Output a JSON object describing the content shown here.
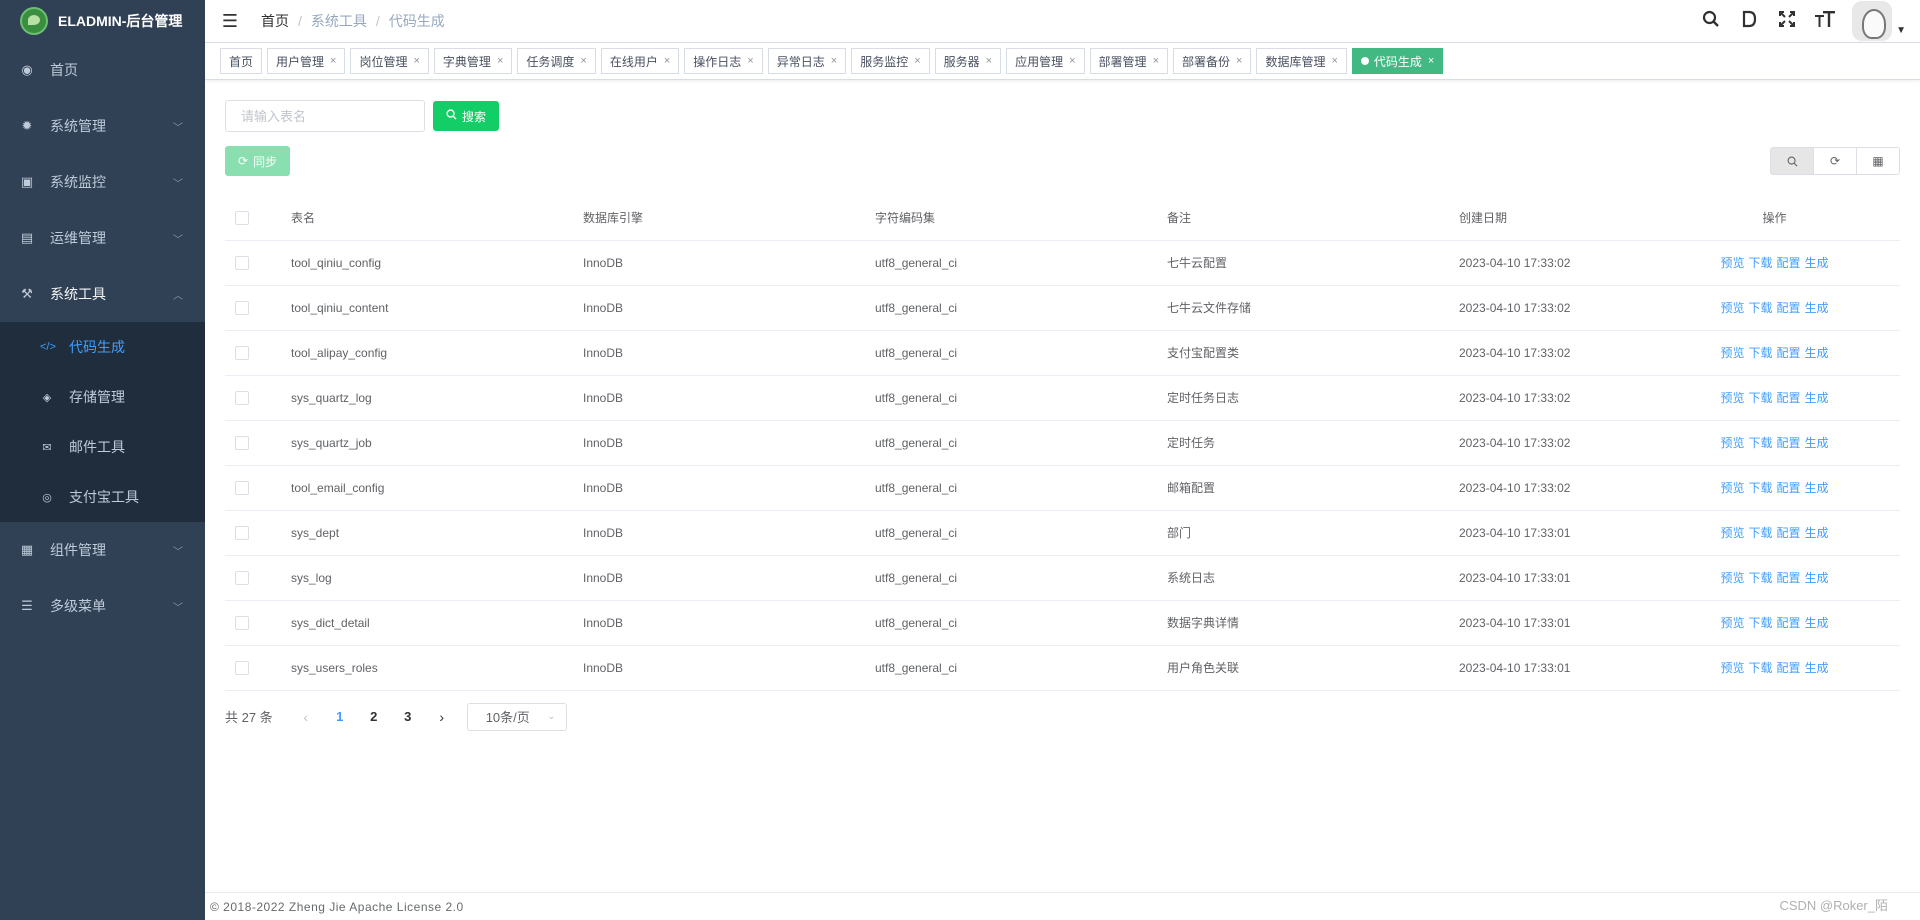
{
  "app": {
    "title": "ELADMIN-后台管理"
  },
  "sidebar": {
    "items": [
      {
        "label": "首页",
        "icon": "dashboard-icon",
        "glyph": "◉",
        "has_children": false
      },
      {
        "label": "系统管理",
        "icon": "gear-icon",
        "glyph": "✹",
        "has_children": true
      },
      {
        "label": "系统监控",
        "icon": "monitor-icon",
        "glyph": "▣",
        "has_children": true
      },
      {
        "label": "运维管理",
        "icon": "ops-icon",
        "glyph": "▤",
        "has_children": true
      },
      {
        "label": "系统工具",
        "icon": "tools-icon",
        "glyph": "⚒",
        "has_children": true,
        "open": true
      },
      {
        "label": "组件管理",
        "icon": "components-icon",
        "glyph": "▦",
        "has_children": true
      },
      {
        "label": "多级菜单",
        "icon": "menu-icon",
        "glyph": "☰",
        "has_children": true
      }
    ],
    "tool_children": [
      {
        "label": "代码生成",
        "icon": "code-icon",
        "glyph": "</>",
        "active": true
      },
      {
        "label": "存储管理",
        "icon": "storage-icon",
        "glyph": "◈"
      },
      {
        "label": "邮件工具",
        "icon": "mail-icon",
        "glyph": "✉"
      },
      {
        "label": "支付宝工具",
        "icon": "alipay-icon",
        "glyph": "◎"
      }
    ]
  },
  "breadcrumb": [
    "首页",
    "系统工具",
    "代码生成"
  ],
  "tags": [
    {
      "label": "首页",
      "closable": false
    },
    {
      "label": "用户管理",
      "closable": true
    },
    {
      "label": "岗位管理",
      "closable": true
    },
    {
      "label": "字典管理",
      "closable": true
    },
    {
      "label": "任务调度",
      "closable": true
    },
    {
      "label": "在线用户",
      "closable": true
    },
    {
      "label": "操作日志",
      "closable": true
    },
    {
      "label": "异常日志",
      "closable": true
    },
    {
      "label": "服务监控",
      "closable": true
    },
    {
      "label": "服务器",
      "closable": true
    },
    {
      "label": "应用管理",
      "closable": true
    },
    {
      "label": "部署管理",
      "closable": true
    },
    {
      "label": "部署备份",
      "closable": true
    },
    {
      "label": "数据库管理",
      "closable": true
    },
    {
      "label": "代码生成",
      "closable": true,
      "active": true
    }
  ],
  "search": {
    "placeholder": "请输入表名",
    "value": "",
    "button": "搜索"
  },
  "toolbar": {
    "sync": "同步"
  },
  "table": {
    "headers": [
      "表名",
      "数据库引擎",
      "字符编码集",
      "备注",
      "创建日期",
      "操作"
    ],
    "actions": [
      "预览",
      "下载",
      "配置",
      "生成"
    ],
    "rows": [
      [
        "tool_qiniu_config",
        "InnoDB",
        "utf8_general_ci",
        "七牛云配置",
        "2023-04-10 17:33:02"
      ],
      [
        "tool_qiniu_content",
        "InnoDB",
        "utf8_general_ci",
        "七牛云文件存储",
        "2023-04-10 17:33:02"
      ],
      [
        "tool_alipay_config",
        "InnoDB",
        "utf8_general_ci",
        "支付宝配置类",
        "2023-04-10 17:33:02"
      ],
      [
        "sys_quartz_log",
        "InnoDB",
        "utf8_general_ci",
        "定时任务日志",
        "2023-04-10 17:33:02"
      ],
      [
        "sys_quartz_job",
        "InnoDB",
        "utf8_general_ci",
        "定时任务",
        "2023-04-10 17:33:02"
      ],
      [
        "tool_email_config",
        "InnoDB",
        "utf8_general_ci",
        "邮箱配置",
        "2023-04-10 17:33:02"
      ],
      [
        "sys_dept",
        "InnoDB",
        "utf8_general_ci",
        "部门",
        "2023-04-10 17:33:01"
      ],
      [
        "sys_log",
        "InnoDB",
        "utf8_general_ci",
        "系统日志",
        "2023-04-10 17:33:01"
      ],
      [
        "sys_dict_detail",
        "InnoDB",
        "utf8_general_ci",
        "数据字典详情",
        "2023-04-10 17:33:01"
      ],
      [
        "sys_users_roles",
        "InnoDB",
        "utf8_general_ci",
        "用户角色关联",
        "2023-04-10 17:33:01"
      ]
    ]
  },
  "pagination": {
    "total": "共 27 条",
    "pages": [
      "1",
      "2",
      "3"
    ],
    "current": "1",
    "page_size": "10条/页"
  },
  "footer": {
    "text": "© 2018-2022 Zheng Jie Apache License 2.0"
  },
  "watermark": "CSDN @Roker_陌",
  "colors": {
    "sidebar_bg": "#304156",
    "submenu_bg": "#1f2d3d",
    "active_tag": "#42b983",
    "primary": "#409eff",
    "search_btn": "#13ce66"
  }
}
